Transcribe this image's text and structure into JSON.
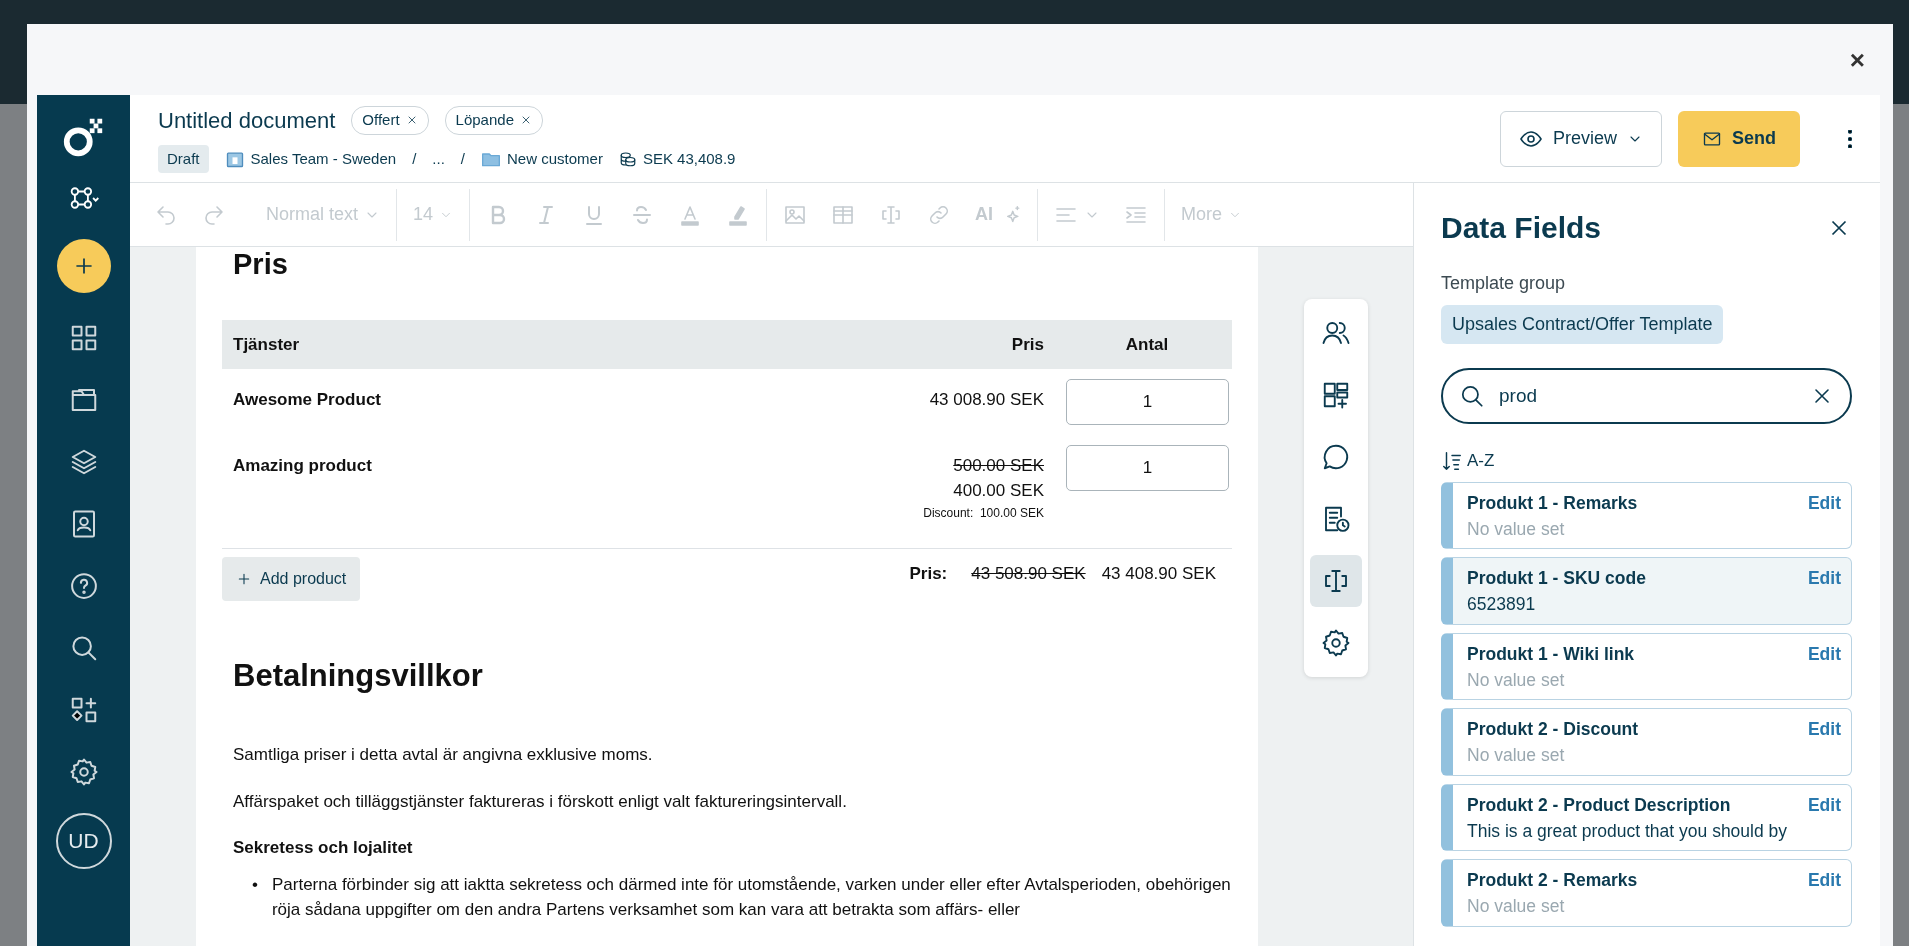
{
  "modal": {
    "close": "×"
  },
  "sidebar": {
    "avatar": "UD"
  },
  "header": {
    "title": "Untitled document",
    "tags": [
      "Offert",
      "Löpande"
    ],
    "status": "Draft",
    "breadcrumb": [
      {
        "text": "Sales Team - Sweden",
        "kind": "team"
      },
      {
        "text": "/",
        "kind": "sep"
      },
      {
        "text": "...",
        "kind": "plain"
      },
      {
        "text": "/",
        "kind": "sep"
      },
      {
        "text": "New customer",
        "kind": "folder"
      }
    ],
    "amount": "SEK 43,408.9",
    "preview": "Preview",
    "send": "Send"
  },
  "toolbar": {
    "text_style": "Normal text",
    "font_size": "14",
    "ai": "AI",
    "more": "More"
  },
  "document": {
    "heading": "Pris",
    "table": {
      "columns": [
        "Tjänster",
        "Pris",
        "Antal"
      ],
      "rows": [
        {
          "name": "Awesome Product",
          "price": "43 008.90 SEK",
          "quantity": "1"
        },
        {
          "name": "Amazing product",
          "old_price": "500.00 SEK",
          "price": "400.00 SEK",
          "discount_label": "Discount:",
          "discount": "100.00 SEK",
          "quantity": "1"
        }
      ]
    },
    "add_product": "Add product",
    "total_label": "Pris:",
    "total_old": "43 508.90 SEK",
    "total": "43 408.90 SEK",
    "section_title": "Betalningsvillkor",
    "paragraphs": [
      "Samtliga priser i detta avtal är angivna exklusive moms.",
      "Affärspaket och tilläggstjänster faktureras i förskott enligt valt faktureringsintervall."
    ],
    "subheading": "Sekretess och lojalitet",
    "bullets": [
      {
        "marker": "•",
        "text": "Parterna förbinder sig att iaktta sekretess och därmed inte för utomstående, varken under eller efter Avtalsperioden, obehörigen röja sådana uppgifter om den andra Partens verksamhet som kan vara att betrakta som affärs- eller"
      }
    ]
  },
  "tool_rail": [
    {
      "selected": false
    },
    {
      "selected": false
    },
    {
      "selected": false
    },
    {
      "selected": false
    },
    {
      "selected": true
    },
    {
      "selected": false
    }
  ],
  "data_fields": {
    "title": "Data Fields",
    "group_label": "Template group",
    "group": "Upsales Contract/Offer Template",
    "search": "prod",
    "sort": "A-Z",
    "fields": [
      {
        "name": "Produkt 1 - Remarks",
        "value": "No value set",
        "empty": true,
        "highlighted": false,
        "action": "Edit"
      },
      {
        "name": "Produkt 1 - SKU code",
        "value": "6523891",
        "empty": false,
        "highlighted": true,
        "action": "Edit"
      },
      {
        "name": "Produkt 1 - Wiki link",
        "value": "No value set",
        "empty": true,
        "highlighted": false,
        "action": "Edit"
      },
      {
        "name": "Produkt 2 - Discount",
        "value": "No value set",
        "empty": true,
        "highlighted": false,
        "action": "Edit"
      },
      {
        "name": "Produkt 2 - Product Description",
        "value": "This is a great product that you should by",
        "empty": false,
        "highlighted": false,
        "action": "Edit"
      },
      {
        "name": "Produkt 2 - Remarks",
        "value": "No value set",
        "empty": true,
        "highlighted": false,
        "action": "Edit"
      }
    ]
  }
}
